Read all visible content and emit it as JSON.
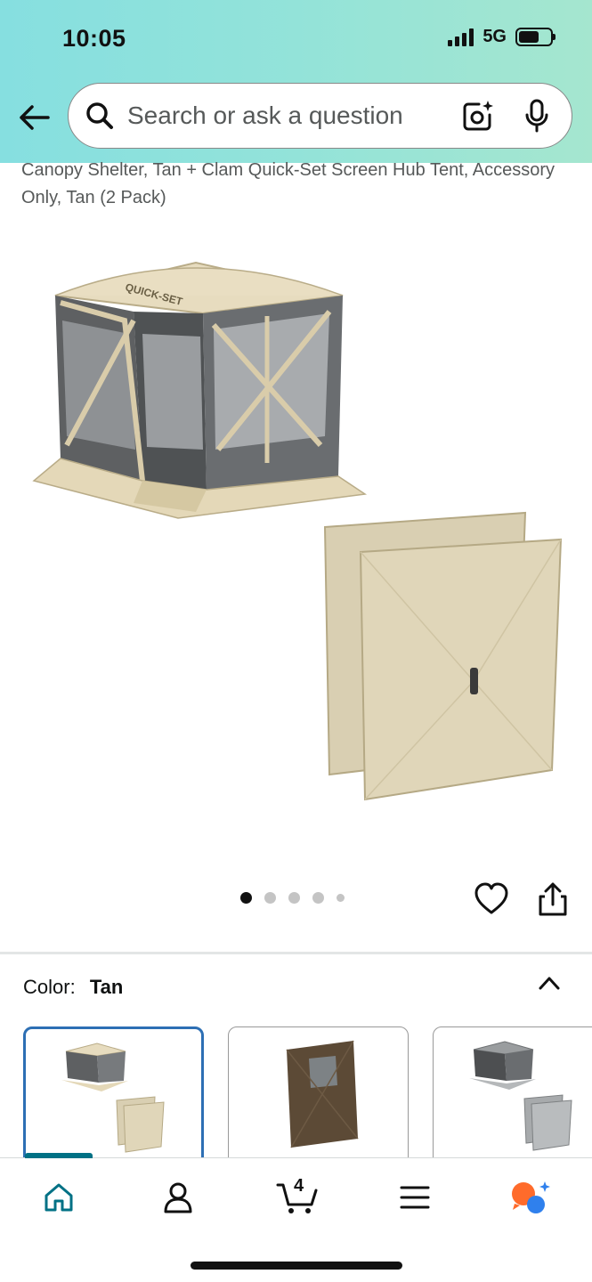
{
  "status_bar": {
    "time": "10:05",
    "network": "5G"
  },
  "search": {
    "placeholder": "Search or ask a question"
  },
  "product": {
    "title": "Canopy Shelter, Tan + Clam Quick-Set Screen Hub Tent, Accessory Only, Tan (2 Pack)",
    "brand_mark_on_image": "QUICK-SET"
  },
  "image_carousel": {
    "total_images": 5,
    "active_index": 0
  },
  "color_selector": {
    "label": "Color:",
    "selected": "Tan",
    "options": [
      "Tan",
      "Brown",
      "Gray"
    ]
  },
  "bottom_nav": {
    "items": [
      "home",
      "account",
      "cart",
      "menu",
      "rufus"
    ],
    "active": "home",
    "cart_count": "4"
  },
  "colors": {
    "header_gradient_start": "#86dfe0",
    "header_gradient_end": "#a5e6cf",
    "accent_teal": "#007185",
    "selected_border": "#2d6fb4",
    "rufus_orange": "#ff6b2b",
    "rufus_blue": "#2f80ed"
  }
}
